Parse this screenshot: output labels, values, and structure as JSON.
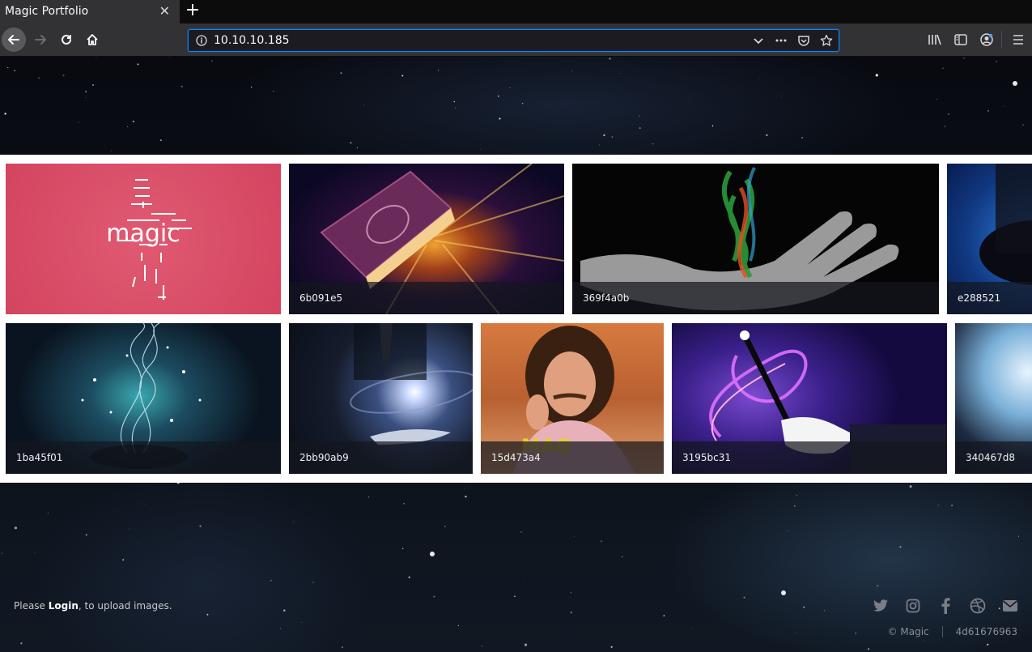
{
  "browser": {
    "tab_title": "Magic Portfolio",
    "close_glyph": "✕",
    "new_tab_glyph": "+",
    "url": "10.10.10.185"
  },
  "gallery": {
    "row1": [
      {
        "caption": "",
        "theme": "magic-logo"
      },
      {
        "caption": "6b091e5",
        "theme": "book"
      },
      {
        "caption": "369f4a0b",
        "theme": "hand-smoke"
      },
      {
        "caption": "e288521",
        "theme": "hat"
      }
    ],
    "row2": [
      {
        "caption": "1ba45f01",
        "theme": "sparkles"
      },
      {
        "caption": "2bb90ab9",
        "theme": "galaxy-hand"
      },
      {
        "caption": "15d473a4",
        "theme": "man"
      },
      {
        "caption": "3195bc31",
        "theme": "wand"
      },
      {
        "caption": "340467d8",
        "theme": "water"
      }
    ],
    "logo_text": "magic",
    "man_overlay_text": "MAG"
  },
  "footer": {
    "login_prefix": "Please ",
    "login_link": "Login",
    "login_suffix": ", to upload images.",
    "copyright": "© Magic",
    "hash": "4d61676963",
    "social": [
      "twitter-icon",
      "instagram-icon",
      "facebook-icon",
      "dribbble-icon",
      "mail-icon"
    ]
  },
  "colors": {
    "chrome_dark": "#0c0c0d",
    "chrome": "#323234",
    "url_focus": "#0a84ff",
    "logo_tile": "#d84a64"
  }
}
